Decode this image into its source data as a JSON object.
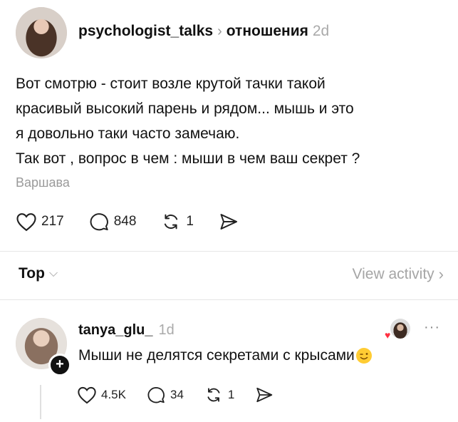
{
  "post": {
    "username": "psychologist_talks",
    "topic": "отношения",
    "age": "2d",
    "lines": [
      "Вот смотрю - стоит возле крутой тачки такой",
      "красивый высокий парень и рядом... мышь и это",
      "я довольно таки часто замечаю.",
      "Так вот , вопрос в чем : мыши в чем ваш секрет ?"
    ],
    "location": "Варшава",
    "likes": "217",
    "comments": "848",
    "reposts": "1"
  },
  "sort": {
    "label": "Top",
    "view_activity": "View activity"
  },
  "reply": {
    "username": "tanya_glu_",
    "age": "1d",
    "text": "Мыши не делятся секретами с крысами",
    "likes": "4.5K",
    "comments": "34",
    "reposts": "1"
  },
  "icons": {
    "heart": "heart-icon",
    "comment": "comment-icon",
    "repost": "repost-icon",
    "share": "share-icon",
    "chevron": "chevron-right-icon",
    "more": "more-icon"
  }
}
